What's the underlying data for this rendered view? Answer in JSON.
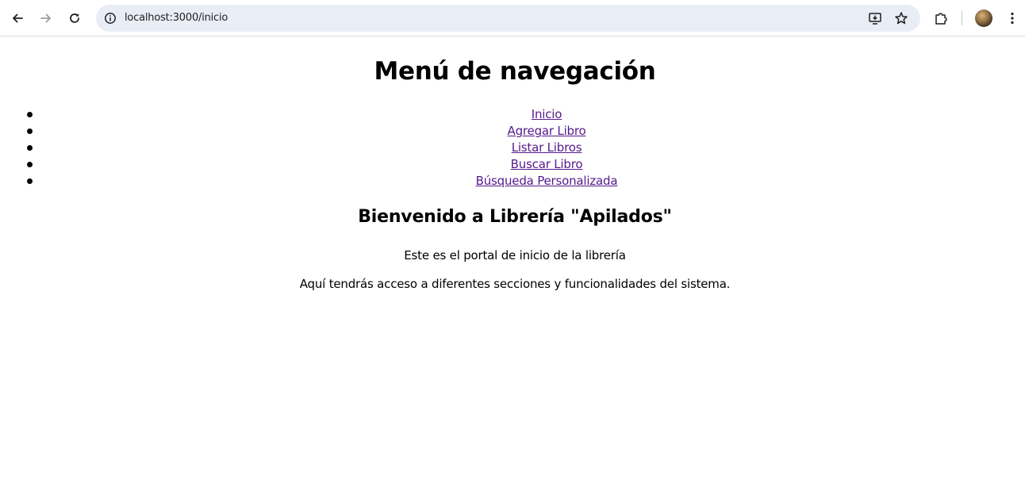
{
  "browser": {
    "url": "localhost:3000/inicio",
    "icons": {
      "back": "arrow-left-icon",
      "forward": "arrow-right-icon",
      "reload": "reload-icon",
      "site_info": "info-circle-icon",
      "install": "install-app-icon",
      "bookmark": "star-icon",
      "extensions": "puzzle-icon",
      "profile": "avatar",
      "menu": "more-vert-icon"
    }
  },
  "page": {
    "title": "Menú de navegación",
    "nav": [
      {
        "label": "Inicio"
      },
      {
        "label": "Agregar Libro"
      },
      {
        "label": "Listar Libros"
      },
      {
        "label": "Buscar Libro"
      },
      {
        "label": "Búsqueda Personalizada"
      }
    ],
    "welcome_heading": "Bienvenido a Librería \"Apilados\"",
    "paragraphs": [
      "Este es el portal de inicio de la librería",
      "Aquí tendrás acceso a diferentes secciones y funcionalidades del sistema."
    ]
  },
  "colors": {
    "link_visited": "#551a8b",
    "omnibox_bg": "#e9edf6"
  }
}
